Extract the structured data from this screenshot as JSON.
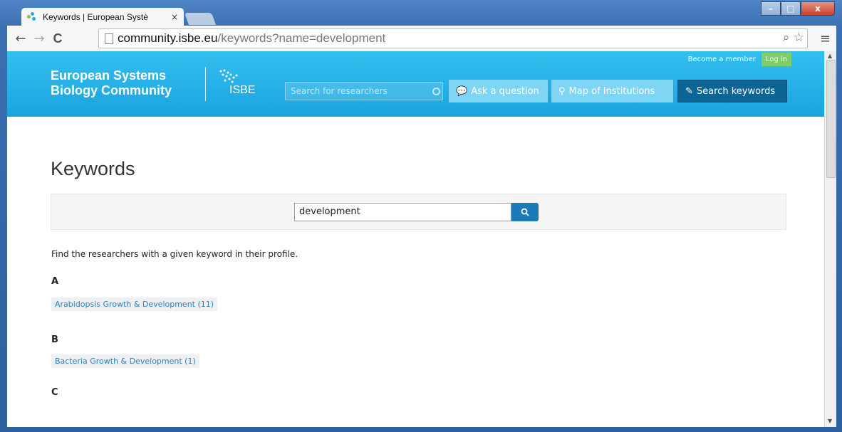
{
  "browser": {
    "tab_title": "Keywords | European Systè",
    "tab_close": "×",
    "url_host": "community.isbe.eu",
    "url_path": "/keywords?name=development",
    "omni_icons": "⌕ ☆",
    "menu_icon": "≡",
    "back": "←",
    "forward": "→",
    "reload": "C",
    "win_min": "–",
    "win_max": "□",
    "win_close": "x"
  },
  "header": {
    "brand_line1": "European Systems",
    "brand_line2": "Biology Community",
    "logo_text": "ISBE",
    "become_member": "Become a member",
    "login": "Log in",
    "search_placeholder": "Search for researchers",
    "nav": {
      "ask": "Ask a question",
      "map": "Map of Institutions",
      "keywords": "Search keywords"
    }
  },
  "main": {
    "title": "Keywords",
    "search_value": "development",
    "intro": "Find the researchers with a given keyword in their profile.",
    "groups": [
      {
        "letter": "A",
        "items": [
          "Arabidopsis Growth & Development (11)"
        ]
      },
      {
        "letter": "B",
        "items": [
          "Bacteria Growth & Development (1)"
        ]
      },
      {
        "letter": "C",
        "items": []
      }
    ]
  },
  "colors": {
    "header_blue": "#1aa3de",
    "link_blue": "#2d7fbd",
    "active_nav": "#0d6596",
    "login_green": "#7ecf6b"
  }
}
